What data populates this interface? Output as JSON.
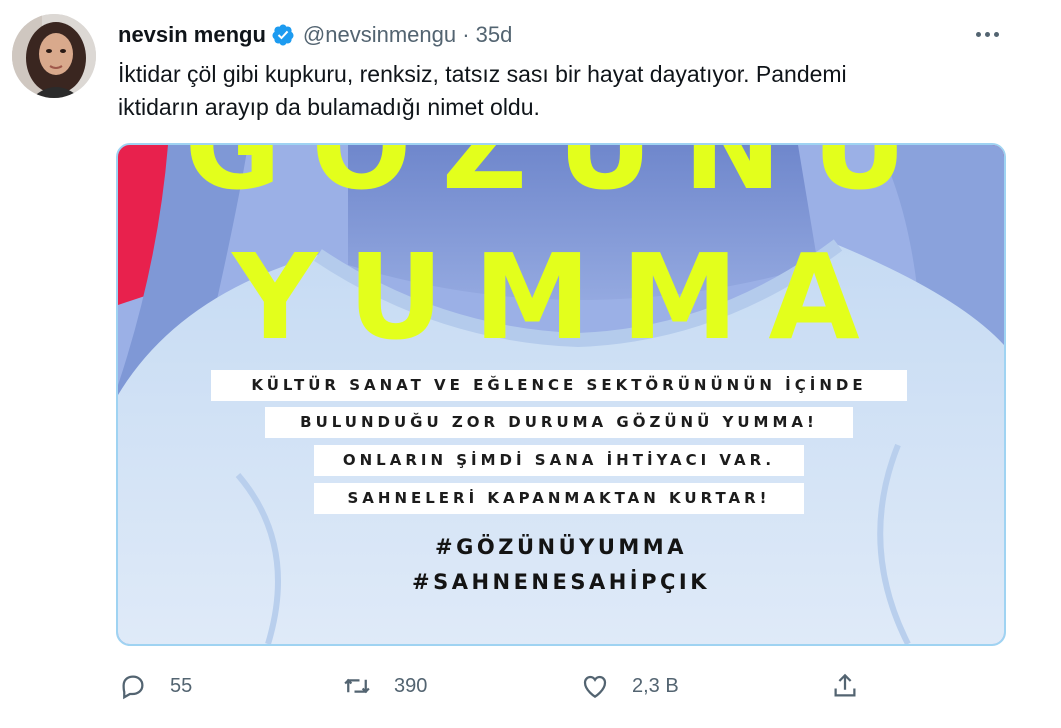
{
  "tweet": {
    "author_name": "nevsin mengu",
    "handle_time": "@nevsinmengu · 35d",
    "text_line1": "İktidar çöl gibi kupkuru, renksiz, tatsız sası bir hayat dayatıyor. Pandemi",
    "text_line2": "iktidarın arayıp da bulamadığı nimet oldu."
  },
  "media": {
    "headline1": "GÖZÜNÜ",
    "headline2": "YUMMA",
    "lines": [
      "KÜLTÜR SANAT VE EĞLENCE SEKTÖRÜNÜNÜN İÇİNDE",
      "BULUNDUĞU ZOR DURUMA GÖZÜNÜ YUMMA!",
      "ONLARIN ŞİMDİ SANA İHTİYACI VAR.",
      "SAHNELERİ KAPANMAKTAN KURTAR!"
    ],
    "hashtag1": "#GÖZÜNÜYUMMA",
    "hashtag2": "#SAHNENESAHİPÇIK"
  },
  "actions": {
    "replies": "55",
    "retweets": "390",
    "likes": "2,3 B"
  },
  "colors": {
    "verified": "#1d9bf0",
    "headline": "#e3ff1c",
    "media_border": "#9fd3f2",
    "muted": "#536471"
  }
}
